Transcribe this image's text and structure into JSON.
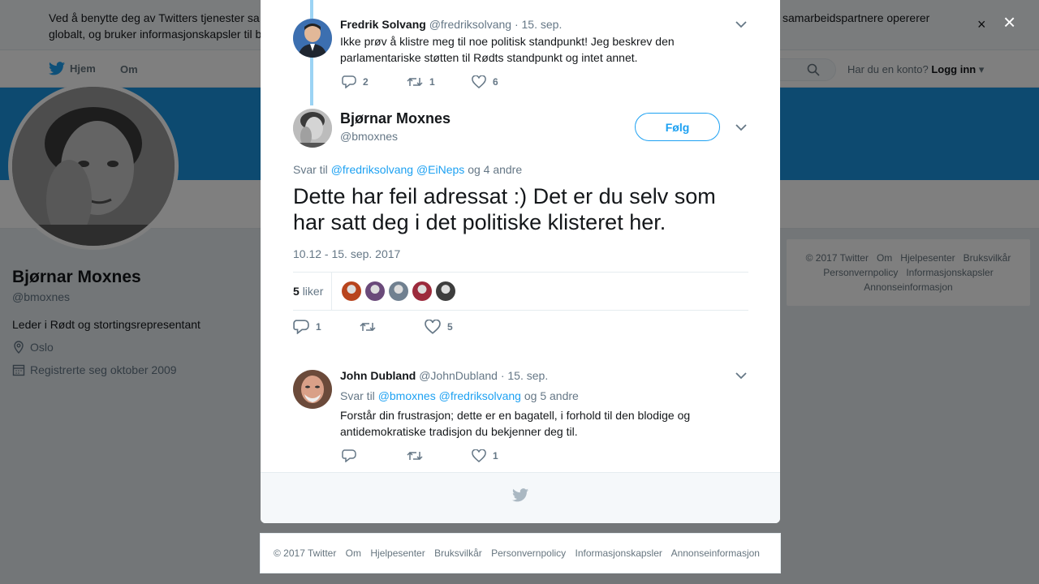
{
  "cookie_banner": {
    "text_left_1": "Ved å benytte deg av Twitters tjenester sa",
    "text_right_1": "samarbeidspartnere opererer",
    "text_left_2": "globalt, og bruker informasjonskapsler til b",
    "close": "×"
  },
  "nav": {
    "home": "Hjem",
    "about": "Om",
    "account_question": "Har du en konto?",
    "login": "Logg inn"
  },
  "profile": {
    "name": "Bjørnar Moxnes",
    "handle": "@bmoxnes",
    "bio": "Leder i Rødt og stortingsrepresentant",
    "location": "Oslo",
    "joined": "Registrerte seg oktober 2009"
  },
  "side_footer": {
    "links": [
      "© 2017 Twitter",
      "Om",
      "Hjelpesenter",
      "Bruksvilkår",
      "Personvernpolicy",
      "Informasjonskapsler",
      "Annonseinformasjon"
    ]
  },
  "overlay_close": "×",
  "parent_tweet": {
    "name": "Fredrik Solvang",
    "handle": "@fredriksolvang",
    "date": "· 15. sep.",
    "text": "Ikke prøv å klistre meg til noe politisk standpunkt! Jeg beskrev den parlamentariske støtten til Rødts standpunkt og intet annet.",
    "replies": "2",
    "retweets": "1",
    "likes": "6"
  },
  "main_tweet": {
    "name": "Bjørnar Moxnes",
    "handle": "@bmoxnes",
    "follow": "Følg",
    "reply_prefix": "Svar til",
    "mention_1": "@fredriksolvang",
    "mention_2": "@EiNeps",
    "reply_suffix": "og 4 andre",
    "text": "Dette har feil adressat :) Det er du selv som har satt deg i det politiske klisteret her.",
    "timestamp": "10.12 - 15. sep. 2017",
    "likes_count": "5",
    "likes_label": "liker",
    "replies": "1",
    "likes": "5",
    "liker_colors": [
      "#b8441d",
      "#6a4a7a",
      "#708090",
      "#9c2a3c",
      "#3d3d3d"
    ]
  },
  "reply_tweet": {
    "name": "John Dubland",
    "handle": "@JohnDubland",
    "date": "· 15. sep.",
    "reply_prefix": "Svar til",
    "mention_1": "@bmoxnes",
    "mention_2": "@fredriksolvang",
    "reply_suffix": "og 5 andre",
    "text": "Forstår din frustrasjon; dette er en bagatell, i forhold til den blodige og antidemokratiske tradisjon du bekjenner deg til.",
    "likes": "1"
  },
  "bottom_footer": {
    "links": [
      "© 2017 Twitter",
      "Om",
      "Hjelpesenter",
      "Bruksvilkår",
      "Personvernpolicy",
      "Informasjonskapsler",
      "Annonseinformasjon"
    ]
  },
  "colors": {
    "brand_blue": "#1da1f2",
    "banner_blue": "#1b95e0",
    "thread_line": "#9bd3f4"
  }
}
